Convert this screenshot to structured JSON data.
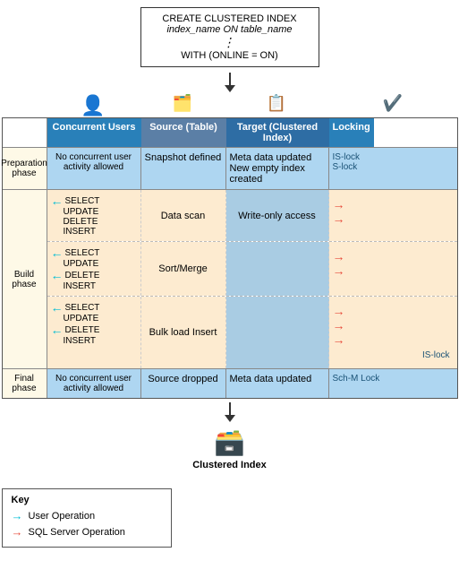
{
  "sql_box": {
    "line1": "CREATE CLUSTERED INDEX",
    "line2": "index_name ON table_name",
    "dots": ":",
    "line3": "WITH (ONLINE = ON)"
  },
  "header": {
    "concurrent_label": "Concurrent Users",
    "source_label": "Source (Table)",
    "target_label": "Target (Clustered Index)",
    "locking_label": "Locking"
  },
  "phases": {
    "preparation": {
      "name": "Preparation phase",
      "concurrent": "No concurrent user activity allowed",
      "source": "Snapshot defined",
      "target_line1": "Meta data updated",
      "target_line2": "New empty index created",
      "lock_line1": "IS-lock",
      "lock_line2": "S-lock"
    },
    "build": {
      "name": "Build phase",
      "sub1": {
        "crud": [
          "SELECT",
          "UPDATE",
          "DELETE",
          "INSERT"
        ],
        "source": "Data scan",
        "target": "Write-only access"
      },
      "sub2": {
        "crud": [
          "SELECT",
          "UPDATE",
          "DELETE",
          "INSERT"
        ],
        "source": "Sort/Merge",
        "target": ""
      },
      "sub3": {
        "crud": [
          "SELECT",
          "UPDATE",
          "DELETE",
          "INSERT"
        ],
        "source": "Bulk load Insert",
        "target": "",
        "lock": "IS-lock"
      }
    },
    "final": {
      "name": "Final phase",
      "concurrent": "No concurrent user activity allowed",
      "source": "Source dropped",
      "target": "Meta data updated",
      "lock": "Sch-M Lock"
    }
  },
  "key": {
    "title": "Key",
    "user_op": "User Operation",
    "sql_op": "SQL Server Operation"
  },
  "bottom": {
    "label": "Clustered Index"
  },
  "colors": {
    "header_blue": "#2980b9",
    "header_dark": "#5b7fa6",
    "prep_bg": "#aed6f1",
    "build_bg": "#fdebd0",
    "build_target_bg": "#a9cce3",
    "phase_label_bg": "#fef9e7",
    "arrow_blue": "#00bcd4",
    "arrow_red": "#e74c3c",
    "lock_text": "#1a5276"
  }
}
